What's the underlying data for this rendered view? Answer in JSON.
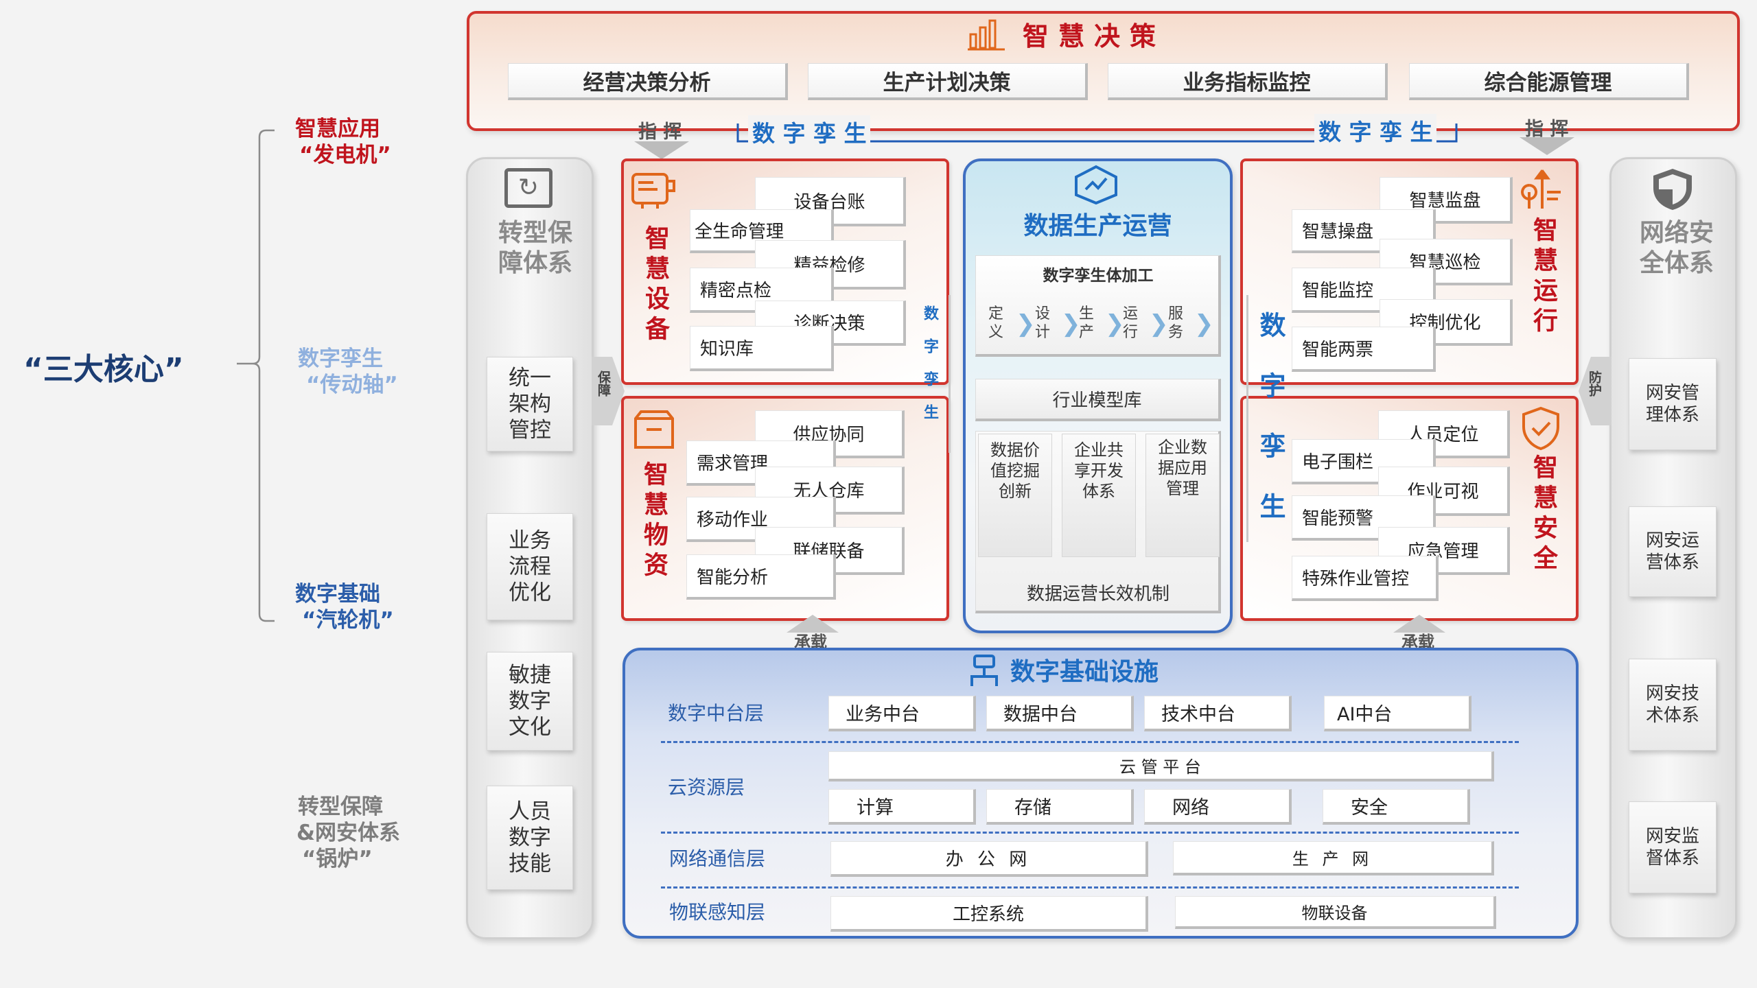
{
  "left_labels": {
    "core_title": "“三大核心”",
    "app_line1": "智慧应用",
    "app_line2": "“发电机”",
    "twin_line1": "数字孪生",
    "twin_line2": "“传动轴”",
    "base_line1": "数字基础",
    "base_line2": "“汽轮机”",
    "boiler_line1": "转型保障",
    "boiler_line2": "&网安体系",
    "boiler_line3": "“锅炉”"
  },
  "decision": {
    "title": "智慧决策",
    "items": [
      "经营决策分析",
      "生产计划决策",
      "业务指标监控",
      "综合能源管理"
    ],
    "command_left": "指 挥",
    "command_right": "指 挥",
    "twin_left": "数 字 孪 生",
    "twin_right": "数 字 孪 生"
  },
  "left_column": {
    "title": "转型保障体系",
    "items": [
      "统一架构管控",
      "业务流程优化",
      "敏捷数字文化",
      "人员数字技能"
    ],
    "arrow_label": "保障"
  },
  "right_column": {
    "title": "网络安全体系",
    "items": [
      "网安管理体系",
      "网安运营体系",
      "网安技术体系",
      "网安监督体系"
    ],
    "arrow_label": "防护"
  },
  "equipment": {
    "title": "智慧设备",
    "right_items": [
      "设备台账",
      "精益检修",
      "诊断决策"
    ],
    "left_items": [
      "全生命管理",
      "精密点检",
      "知识库"
    ]
  },
  "materials": {
    "title": "智慧物资",
    "right_items": [
      "供应协同",
      "无人仓库",
      "联储联备"
    ],
    "left_items": [
      "需求管理",
      "移动作业",
      "智能分析"
    ]
  },
  "operation": {
    "title": "智慧运行",
    "right_items": [
      "智慧监盘",
      "智慧巡检",
      "控制优化"
    ],
    "left_items": [
      "智慧操盘",
      "智能监控",
      "智能两票"
    ]
  },
  "safety": {
    "title": "智慧安全",
    "right_items": [
      "人员定位",
      "作业可视",
      "应急管理"
    ],
    "left_items": [
      "电子围栏",
      "智能预警",
      "特殊作业管控"
    ]
  },
  "twin_vertical_small": "数字孪生",
  "twin_vertical_big": "数字孪生",
  "data_ops": {
    "title": "数据生产运营",
    "twin_process_title": "数字孪生体加工",
    "steps": [
      "定义",
      "设计",
      "生产",
      "运行",
      "服务"
    ],
    "model_lib": "行业模型库",
    "boxes": [
      "数据价值挖掘创新",
      "企业共享开发体系",
      "企业数据应用管理"
    ],
    "mechanism": "数据运营长效机制"
  },
  "support_left": "承载",
  "support_right": "承载",
  "infra": {
    "title": "数字基础设施",
    "layers": [
      {
        "label": "数字中台层",
        "items": [
          "业务中台",
          "数据中台",
          "技术中台",
          "AI中台"
        ]
      },
      {
        "label": "云资源层",
        "platform": "云 管 平 台",
        "items": [
          "计算",
          "存储",
          "网络",
          "安全"
        ]
      },
      {
        "label": "网络通信层",
        "items": [
          "办 公 网",
          "生 产 网"
        ]
      },
      {
        "label": "物联感知层",
        "items": [
          "工控系统",
          "物联设备"
        ]
      }
    ]
  },
  "colors": {
    "red": "#c0141d",
    "blue": "#1f6dc2",
    "navy": "#1c3d73",
    "orange": "#e0661b"
  }
}
